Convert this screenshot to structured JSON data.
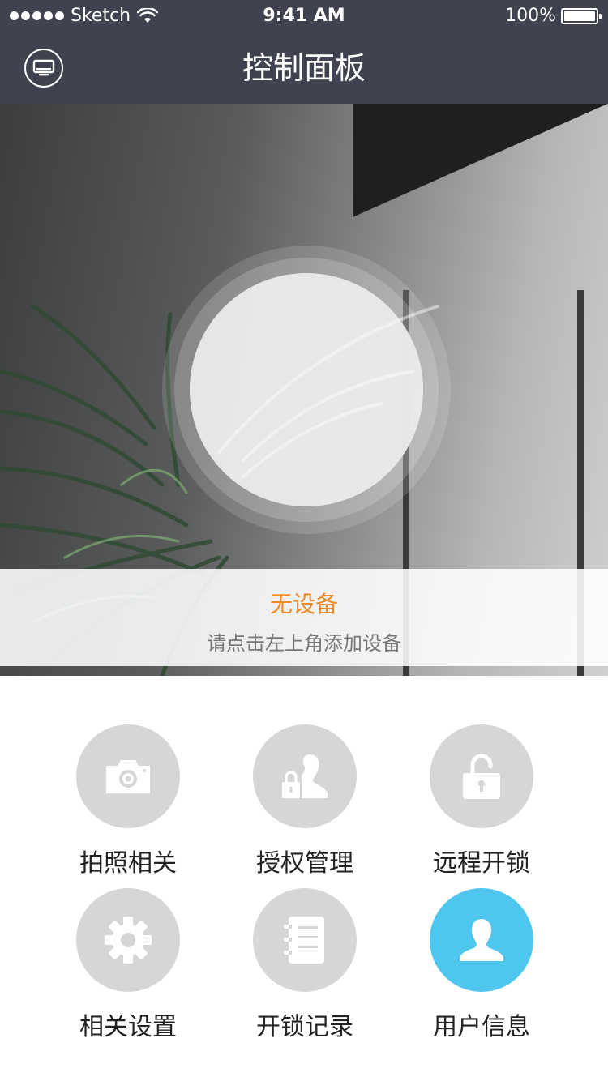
{
  "status_bar": {
    "carrier": "Sketch",
    "time": "9:41 AM",
    "battery": "100%"
  },
  "nav": {
    "title": "控制面板",
    "device_icon": "monitor-icon"
  },
  "hero": {
    "status": "无设备",
    "hint": "请点击左上角添加设备"
  },
  "menu": [
    {
      "label": "拍照相关",
      "icon": "camera-icon"
    },
    {
      "label": "授权管理",
      "icon": "user-lock-icon"
    },
    {
      "label": "远程开锁",
      "icon": "unlock-icon"
    },
    {
      "label": "相关设置",
      "icon": "gear-icon"
    },
    {
      "label": "开锁记录",
      "icon": "notebook-icon"
    },
    {
      "label": "用户信息",
      "icon": "user-icon"
    }
  ],
  "colors": {
    "header_bg": "#41424f",
    "accent_orange": "#f08a24",
    "active_blue": "#4fc6ee",
    "inactive_gray": "#d6d6d6"
  }
}
